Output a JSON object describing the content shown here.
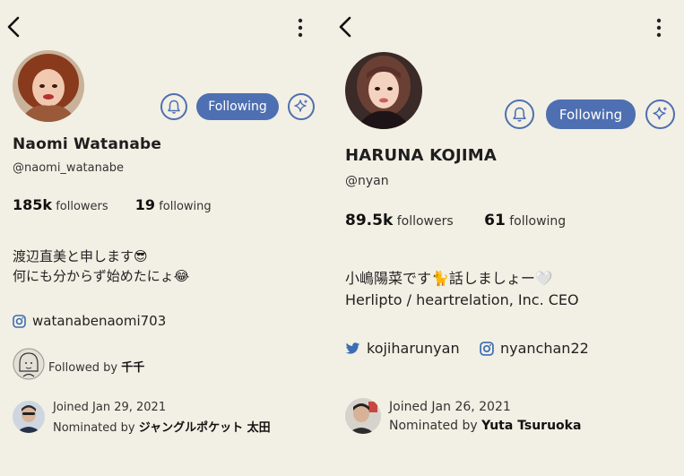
{
  "left": {
    "name": "Naomi Watanabe",
    "handle": "@naomi_watanabe",
    "follow_label": "Following",
    "followers_count": "185k",
    "followers_label": "followers",
    "following_count": "19",
    "following_label": "following",
    "bio_line1": "渡辺直美と申します😎",
    "bio_line2": "何にも分からず始めたにょ😂",
    "instagram": "watanabenaomi703",
    "followed_by_label": "Followed by",
    "followed_by_name": "千千",
    "joined": "Joined Jan 29, 2021",
    "nominated_label": "Nominated by",
    "nominated_name": "ジャングルポケット 太田"
  },
  "right": {
    "name": "HARUNA KOJIMA",
    "handle": "@nyan",
    "follow_label": "Following",
    "followers_count": "89.5k",
    "followers_label": "followers",
    "following_count": "61",
    "following_label": "following",
    "bio_line1": "小嶋陽菜です🐈話しましょー🤍",
    "bio_line2": "Herlipto / heartrelation, Inc. CEO",
    "twitter": "kojiharunyan",
    "instagram": "nyanchan22",
    "joined": "Joined Jan 26, 2021",
    "nominated_label": "Nominated by",
    "nominated_name": "Yuta Tsuruoka"
  },
  "colors": {
    "background": "#f2efe4",
    "accent": "#4e6fb1",
    "twitter": "#3b6db3"
  },
  "icons": [
    "back-arrow-icon",
    "more-vertical-icon",
    "bell-icon",
    "sparkle-icon",
    "instagram-icon",
    "twitter-icon"
  ]
}
